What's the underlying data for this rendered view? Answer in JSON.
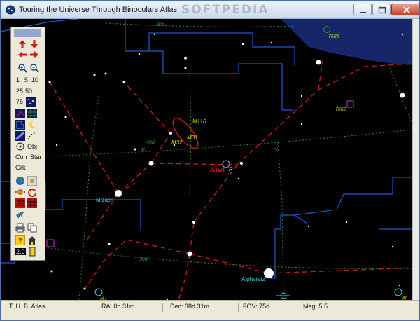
{
  "window": {
    "title": "Touring the Universe Through Binoculars Atlas",
    "watermark": "SOFTPEDIA"
  },
  "palette": {
    "zoom_fields": [
      "1",
      "5",
      "10",
      "25",
      "50",
      "75"
    ],
    "obj_label": "Obj",
    "con_label": "Con",
    "star_label": "Star",
    "grk_label": "Grk",
    "level_label": "2.0"
  },
  "sky": {
    "constellation_label": "And",
    "star_names": [
      "Mizach",
      "Alpheratz"
    ],
    "objects": [
      "M110",
      "M31",
      "M32",
      "R",
      "7686",
      "7662",
      "RT",
      "W"
    ],
    "grid_labels": [
      "30d",
      "40d",
      "1h",
      "0h"
    ],
    "colors": {
      "background": "#000000",
      "constellation_lines": "#cc1f1f",
      "grid_lines": "#2f8f2f",
      "boundaries": "#2255cc",
      "milky_way": "#1a2d7a",
      "object_labels": "#d4d400",
      "star_names": "#33d7d7"
    }
  },
  "status": {
    "app": "T. U. B. Atlas",
    "ra": "RA: 0h 31m",
    "dec": "Dec: 38d 31m",
    "fov": "FOV: 75d",
    "mag": "Mag: 5.5"
  }
}
